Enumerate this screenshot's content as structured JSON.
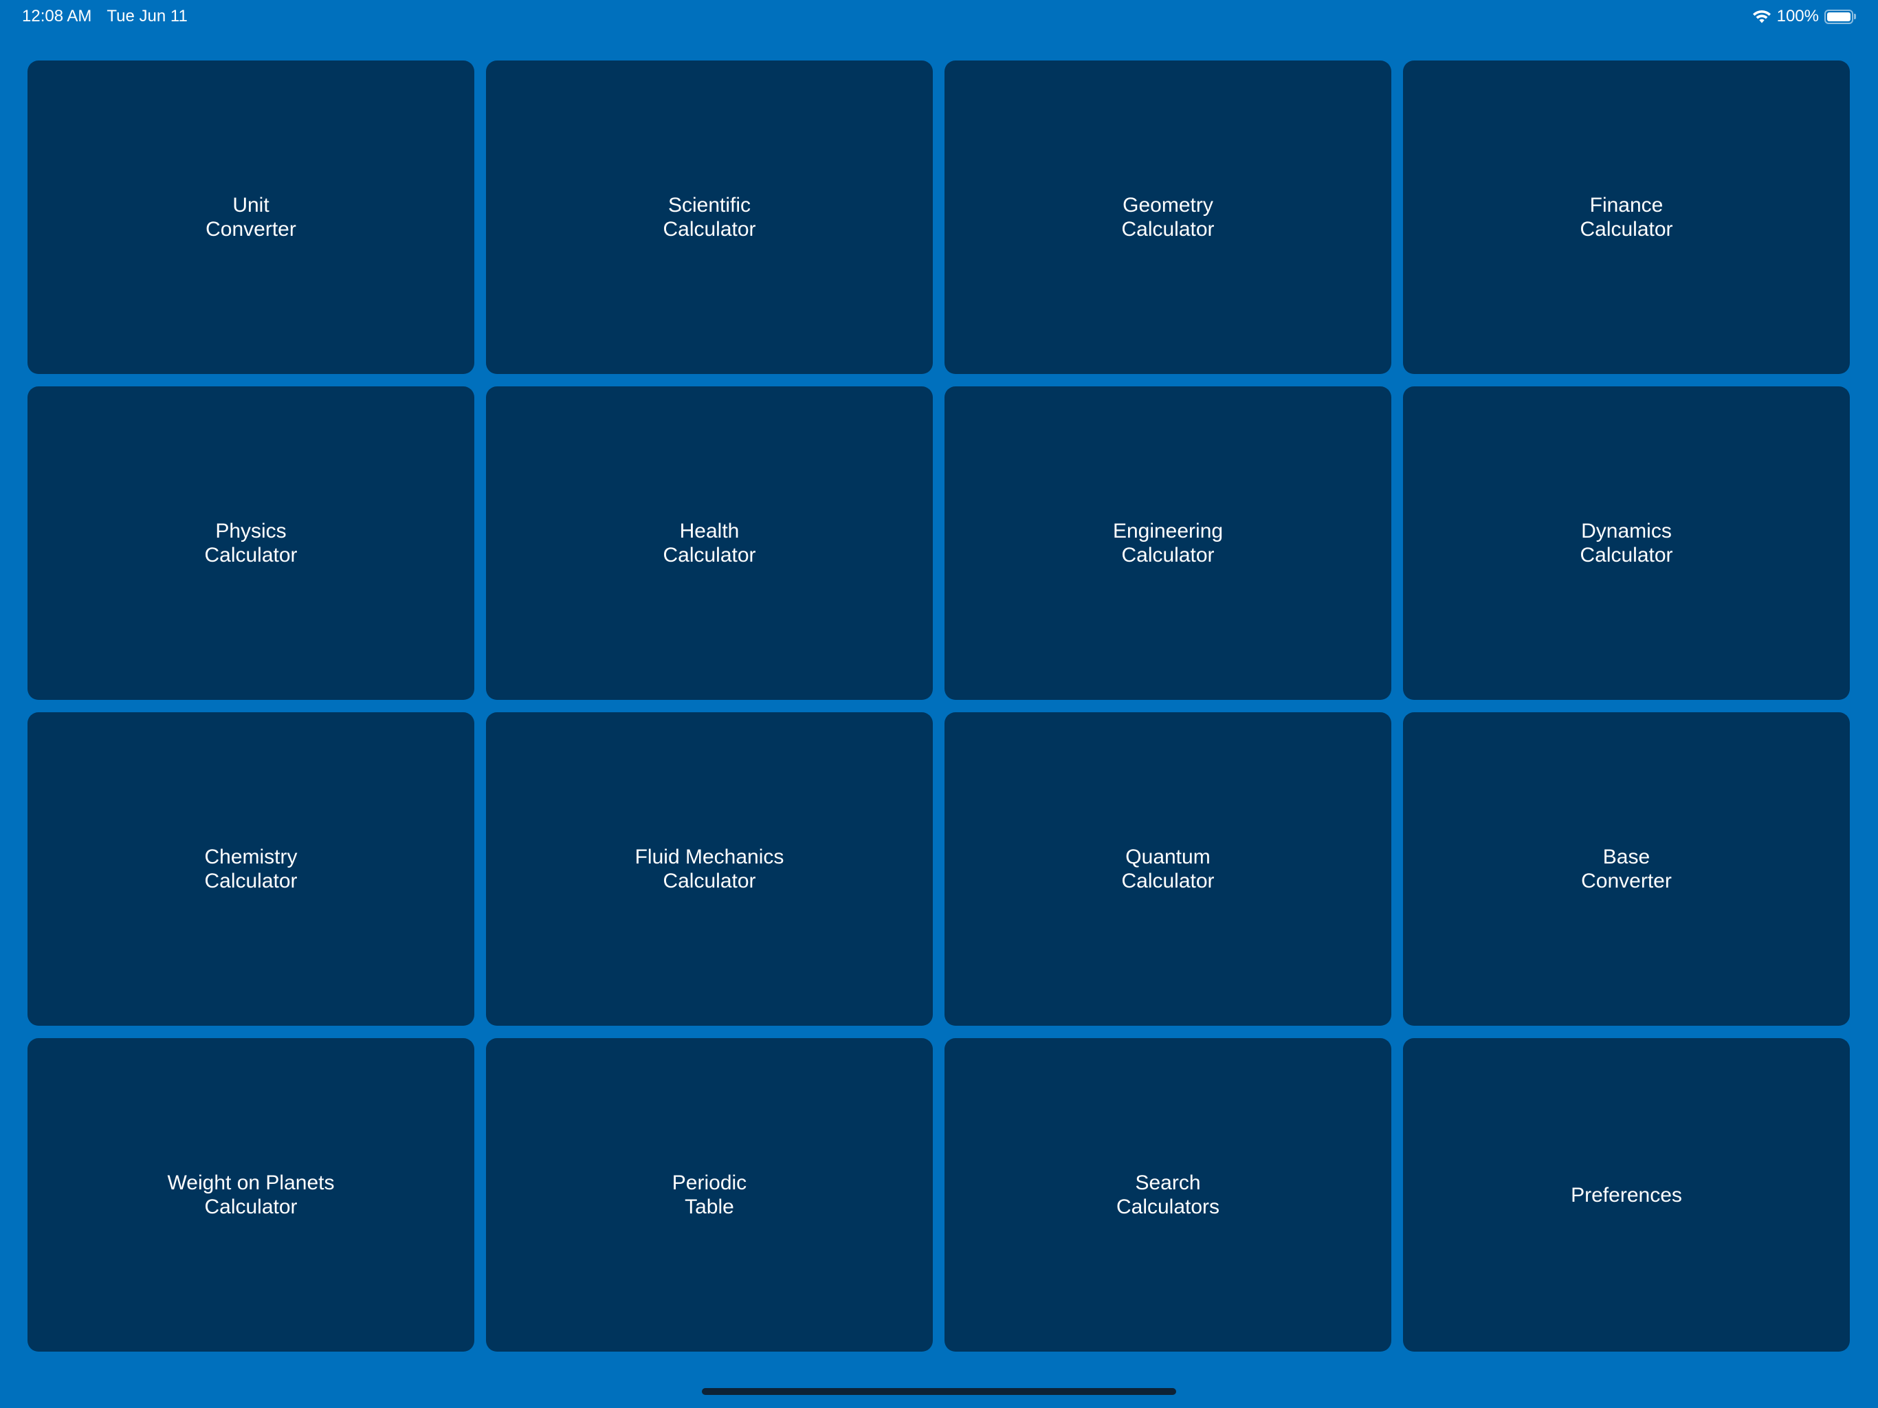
{
  "status_bar": {
    "time": "12:08 AM",
    "date": "Tue Jun 11",
    "battery_text": "100%",
    "battery_level": 1.0
  },
  "tiles": [
    {
      "label": "Unit\nConverter"
    },
    {
      "label": "Scientific\nCalculator"
    },
    {
      "label": "Geometry\nCalculator"
    },
    {
      "label": "Finance\nCalculator"
    },
    {
      "label": "Physics\nCalculator"
    },
    {
      "label": "Health\nCalculator"
    },
    {
      "label": "Engineering\nCalculator"
    },
    {
      "label": "Dynamics\nCalculator"
    },
    {
      "label": "Chemistry\nCalculator"
    },
    {
      "label": "Fluid Mechanics\nCalculator"
    },
    {
      "label": "Quantum\nCalculator"
    },
    {
      "label": "Base\nConverter"
    },
    {
      "label": "Weight on Planets\nCalculator"
    },
    {
      "label": "Periodic\nTable"
    },
    {
      "label": "Search\nCalculators"
    },
    {
      "label": "Preferences"
    }
  ],
  "colors": {
    "background": "#0070BD",
    "tile": "#00345C",
    "text": "#FFFFFF"
  },
  "icons": {
    "wifi": "wifi-icon",
    "battery": "battery-icon"
  }
}
